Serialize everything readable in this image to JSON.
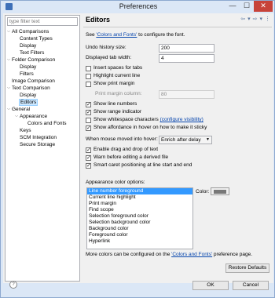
{
  "window": {
    "title": "Preferences"
  },
  "filter": {
    "placeholder": "type filter text"
  },
  "tree": [
    {
      "label": "All Comparisons",
      "toggle": "⌵"
    },
    {
      "label": "Content Types"
    },
    {
      "label": "Display"
    },
    {
      "label": "Text Filters"
    },
    {
      "label": "Folder Comparison",
      "toggle": "⌵"
    },
    {
      "label": "Display"
    },
    {
      "label": "Filters"
    },
    {
      "label": "Image Comparison"
    },
    {
      "label": "Text Comparison",
      "toggle": "⌵"
    },
    {
      "label": "Display"
    },
    {
      "label": "Editors"
    },
    {
      "label": "General",
      "toggle": "⌵"
    },
    {
      "label": "Appearance",
      "toggle": "⌵"
    },
    {
      "label": "Colors and Fonts"
    },
    {
      "label": "Keys"
    },
    {
      "label": "SCM Integration"
    },
    {
      "label": "Secure Storage"
    }
  ],
  "page": {
    "title": "Editors",
    "see_prefix": "See ",
    "see_link": "'Colors and Fonts'",
    "see_suffix": " to configure the font.",
    "undo_label": "Undo history size:",
    "undo_value": "200",
    "tab_label": "Displayed tab width:",
    "tab_value": "4",
    "insert_spaces": "Insert spaces for tabs",
    "highlight_line": "Highlight current line",
    "show_margin": "Show print margin",
    "margin_col_label": "Print margin column:",
    "margin_col_value": "80",
    "line_numbers": "Show line numbers",
    "range_indicator": "Show range indicator",
    "whitespace": "Show whitespace characters",
    "whitespace_link": "(configure visibility)",
    "affordance": "Show affordance in hover on how to make it sticky",
    "hover_label": "When mouse moved into hover:",
    "hover_value": "Enrich after delay",
    "drag_drop": "Enable drag and drop of text",
    "warn_derived": "Warn before editing a derived file",
    "smart_caret": "Smart caret positioning at line start and end",
    "appearance_options": "Appearance color options:",
    "color_label": "Color:",
    "more_prefix": "More colors can be configured on the ",
    "more_link": "'Colors and Fonts'",
    "more_suffix": " preference page.",
    "restore_defaults": "Restore Defaults"
  },
  "color_options": [
    "Line number foreground",
    "Current line highlight",
    "Print margin",
    "Find scope",
    "Selection foreground color",
    "Selection background color",
    "Background color",
    "Foreground color",
    "Hyperlink"
  ],
  "swatch_color": "#787878",
  "buttons": {
    "ok": "OK",
    "cancel": "Cancel"
  },
  "help": "?"
}
